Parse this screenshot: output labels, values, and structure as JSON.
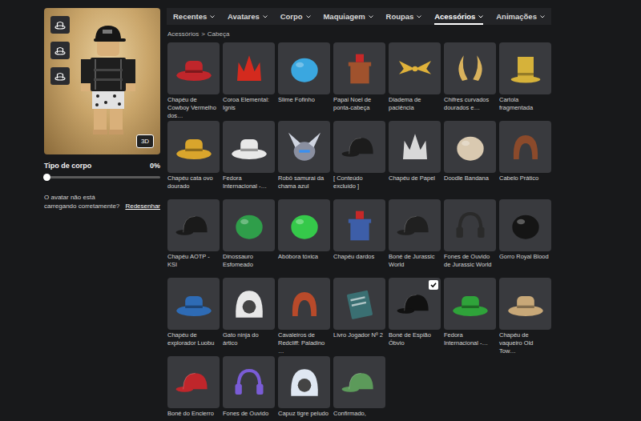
{
  "preview": {
    "view_button": "3D"
  },
  "body_type": {
    "label": "Tipo de corpo",
    "reading": "0%",
    "level": 0
  },
  "help": {
    "text": "O avatar não está carregando corretamente?",
    "link": "Redesenhar"
  },
  "tabs": [
    {
      "label": "Recentes",
      "selected": false
    },
    {
      "label": "Avatares",
      "selected": false
    },
    {
      "label": "Corpo",
      "selected": false
    },
    {
      "label": "Maquiagem",
      "selected": false
    },
    {
      "label": "Roupas",
      "selected": false
    },
    {
      "label": "Acessórios",
      "selected": true
    },
    {
      "label": "Animações",
      "selected": false
    }
  ],
  "breadcrumb": {
    "items": [
      "Acessórios",
      "Cabeça"
    ],
    "separator": ">"
  },
  "items": [
    {
      "name": "Chapéu de Cowboy Vermelho dos…",
      "kind": "hat",
      "color": "#c0262b",
      "selected": false
    },
    {
      "name": "Coroa Elemental: Ignis",
      "kind": "crown",
      "color": "#d42a1e",
      "selected": false
    },
    {
      "name": "Slime Fofinho",
      "kind": "blob",
      "color": "#3aa7e0",
      "selected": false
    },
    {
      "name": "Papai Noel de ponta-cabeça",
      "kind": "box",
      "color": "#a0522d",
      "selected": false
    },
    {
      "name": "Diadema de paciência",
      "kind": "wings",
      "color": "#e0b23a",
      "selected": false
    },
    {
      "name": "Chifres curvados dourados e…",
      "kind": "horns",
      "color": "#d9b25c",
      "selected": false
    },
    {
      "name": "Cartola fragmentada",
      "kind": "tophat",
      "color": "#d6b23a",
      "selected": false
    },
    {
      "name": "Chapéu cata ovo dourado",
      "kind": "hat",
      "color": "#d9a52c",
      "selected": false
    },
    {
      "name": "Fedora Internacional -…",
      "kind": "hat",
      "color": "#e8e8e8",
      "selected": false
    },
    {
      "name": "Robô samurai da chama azul",
      "kind": "helmet",
      "color": "#8a8fa0",
      "selected": false
    },
    {
      "name": "[ Conteúdo excluído ]",
      "kind": "cap",
      "color": "#1c1c1c",
      "selected": false
    },
    {
      "name": "Chapéu de Papel",
      "kind": "crown",
      "color": "#d8d8d8",
      "selected": false
    },
    {
      "name": "Doodle Bandana",
      "kind": "blob",
      "color": "#d9c9b0",
      "selected": false
    },
    {
      "name": "Cabelo Prático",
      "kind": "hair",
      "color": "#8b4a2b",
      "selected": false
    },
    {
      "name": "Chapéu AOTP - KSI",
      "kind": "cap",
      "color": "#1a1a1a",
      "selected": false
    },
    {
      "name": "Dinossauro Esfomeado",
      "kind": "blob",
      "color": "#2f9e4a",
      "selected": false
    },
    {
      "name": "Abóbora tóxica",
      "kind": "blob",
      "color": "#35c94a",
      "selected": false
    },
    {
      "name": "Chapéu dardos",
      "kind": "box",
      "color": "#3d5ea8",
      "selected": false
    },
    {
      "name": "Boné de Jurassic World",
      "kind": "cap",
      "color": "#202020",
      "selected": false
    },
    {
      "name": "Fones de Ouvido de Jurassic World",
      "kind": "headphones",
      "color": "#2a2a2a",
      "selected": false
    },
    {
      "name": "Gorro Royal Blood",
      "kind": "blob",
      "color": "#151515",
      "selected": false
    },
    {
      "name": "Chapéu de explorador Luobu",
      "kind": "hat",
      "color": "#2e6bb5",
      "selected": false
    },
    {
      "name": "Gato ninja do ártico",
      "kind": "hood",
      "color": "#e8e8e8",
      "selected": false
    },
    {
      "name": "Cavaleiros de Redcliff: Paladino …",
      "kind": "hair",
      "color": "#b84a2a",
      "selected": false
    },
    {
      "name": "Livro Jogador Nº 2",
      "kind": "book",
      "color": "#3a6f72",
      "selected": false
    },
    {
      "name": "Boné de Espião Óbvio",
      "kind": "cap",
      "color": "#111111",
      "selected": true
    },
    {
      "name": "Fedora Internacional -…",
      "kind": "hat",
      "color": "#2fa33a",
      "selected": false
    },
    {
      "name": "Chapéu de vaqueiro Old Tow…",
      "kind": "hat",
      "color": "#c8a878",
      "selected": false
    },
    {
      "name": "Boné do Encierro",
      "kind": "cap",
      "color": "#c0262b",
      "selected": false
    },
    {
      "name": "Fones de Ouvido",
      "kind": "headphones",
      "color": "#7a5cd6",
      "selected": false
    },
    {
      "name": "Capuz tigre peludo",
      "kind": "hood",
      "color": "#dfe7f2",
      "selected": false
    },
    {
      "name": "Confirmado,",
      "kind": "cap",
      "color": "#5c9a5a",
      "selected": false
    }
  ]
}
